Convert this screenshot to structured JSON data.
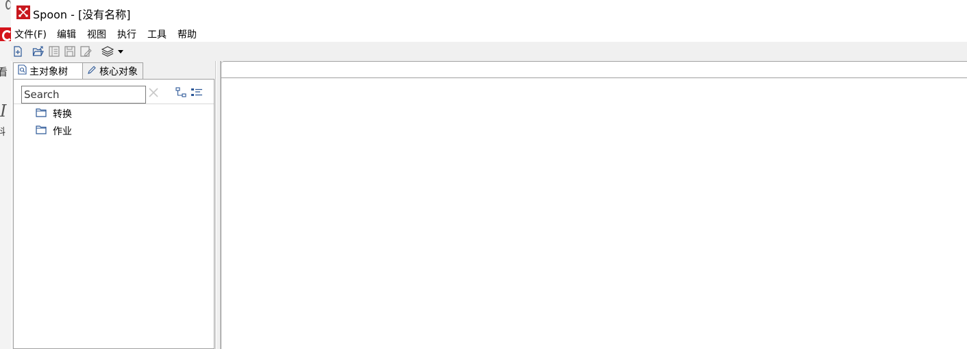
{
  "window": {
    "title": "Spoon - [没有名称]"
  },
  "menu": [
    "文件(F)",
    "编辑",
    "视图",
    "执行",
    "工具",
    "帮助"
  ],
  "toolbar": {
    "buttons": [
      "new-file-icon",
      "open-file-icon",
      "explore-repository-icon",
      "save-icon",
      "save-as-icon",
      "layers-perspective-icon",
      "dropdown-arrow-icon"
    ]
  },
  "left_panel": {
    "tabs": [
      {
        "label": "主对象树",
        "icon": "magnifier-doc-icon"
      },
      {
        "label": "核心对象",
        "icon": "pencil-icon"
      }
    ],
    "search": {
      "placeholder": "Search",
      "value": ""
    },
    "tree": [
      {
        "label": "转换",
        "icon": "folder-icon"
      },
      {
        "label": "作业",
        "icon": "folder-icon"
      }
    ]
  },
  "background_window": {
    "glyphs": [
      "看",
      "I",
      "料"
    ]
  },
  "colors": {
    "brand": "#c8181e",
    "toolbar_bg": "#f0f0f0",
    "icon_blue": "#2b5797"
  }
}
